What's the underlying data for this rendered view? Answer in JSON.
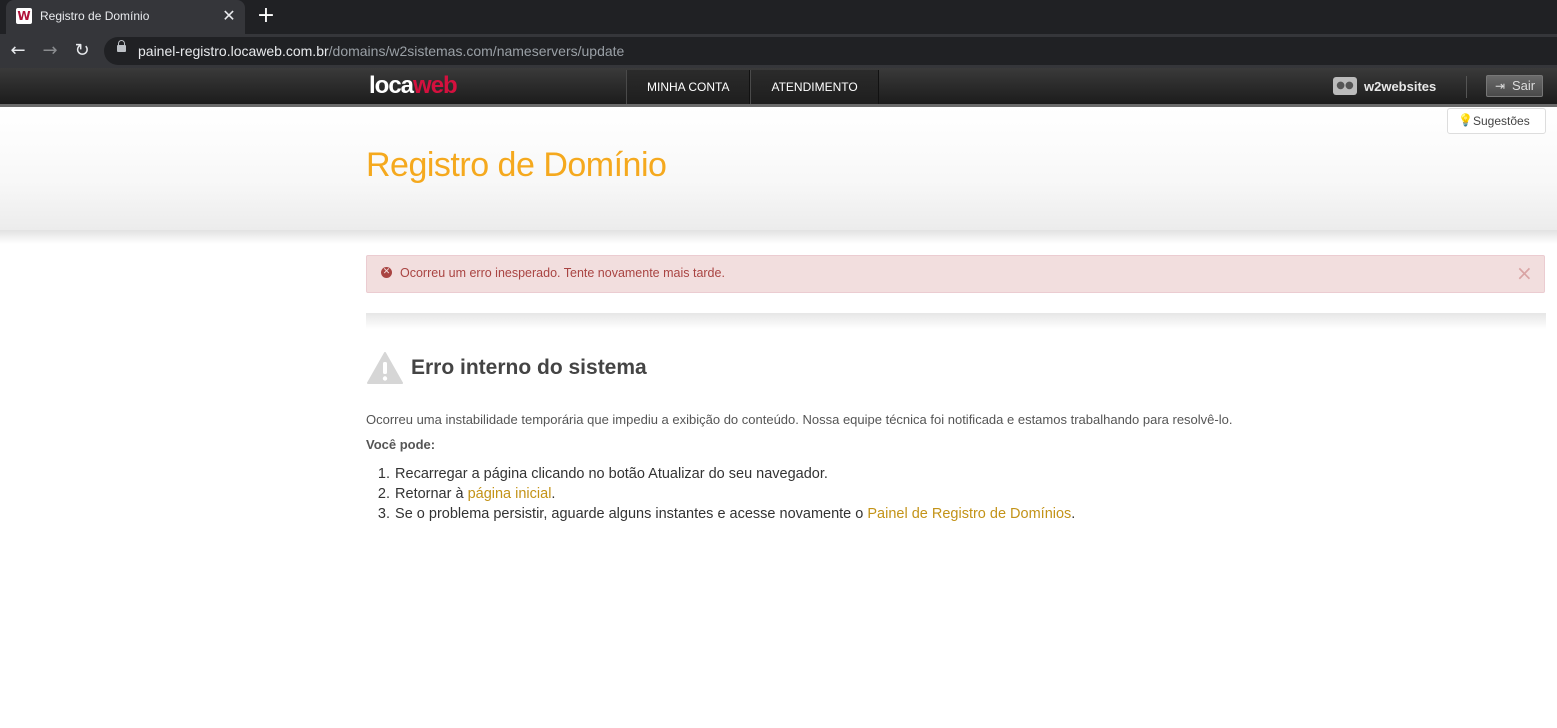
{
  "browser": {
    "tab_title": "Registro de Domínio",
    "favicon_letter": "W",
    "tab_close": "✕",
    "new_tab": "+",
    "nav": {
      "back": "←",
      "forward": "→",
      "reload": "↻"
    },
    "url_host": "painel-registro.locaweb.com.br",
    "url_path": "/domains/w2sistemas.com/nameservers/update"
  },
  "site_header": {
    "logo_part1": "loca",
    "logo_part2": "web",
    "nav_items": [
      "MINHA CONTA",
      "ATENDIMENTO"
    ],
    "username": "w2websites",
    "logout_label": "Sair",
    "logout_icon": "⇥"
  },
  "page": {
    "suggestions_label": "Sugestões",
    "title": "Registro de Domínio"
  },
  "alert": {
    "icon": "✕",
    "message": "Ocorreu um erro inesperado. Tente novamente mais tarde.",
    "close": "×"
  },
  "error": {
    "title": "Erro interno do sistema",
    "description": "Ocorreu uma instabilidade temporária que impediu a exibição do conteúdo. Nossa equipe técnica foi notificada e estamos trabalhando para resolvê-lo.",
    "subtitle": "Você pode:",
    "items": [
      {
        "num": "1.",
        "before": "Recarregar a página clicando no botão Atualizar do seu navegador.",
        "link": "",
        "after": ""
      },
      {
        "num": "2.",
        "before": "Retornar à ",
        "link": "página inicial",
        "after": "."
      },
      {
        "num": "3.",
        "before": "Se o problema persistir, aguarde alguns instantes e acesse novamente o ",
        "link": "Painel de Registro de Domínios",
        "after": "."
      }
    ]
  },
  "colors": {
    "title_orange": "#f5a91e",
    "link_gold": "#c39318",
    "alert_bg": "#f2dede",
    "alert_text": "#a94442",
    "logo_red": "#d4103e"
  }
}
